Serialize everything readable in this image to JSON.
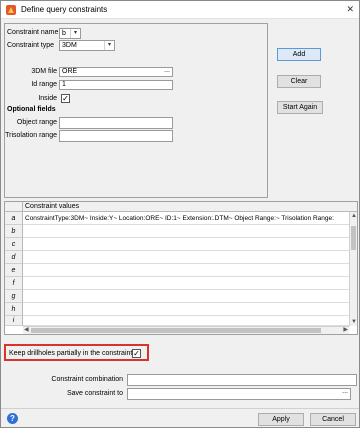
{
  "window": {
    "title": "Define query constraints",
    "close_glyph": "✕"
  },
  "form": {
    "constraint_name_label": "Constraint name",
    "constraint_name_value": "b",
    "constraint_type_label": "Constraint type",
    "constraint_type_value": "3DM",
    "file_label": "3DM file",
    "file_value": "ORE",
    "id_range_label": "Id range",
    "id_range_value": "1",
    "inside_label": "Inside",
    "inside_checked": true,
    "optional_label": "Optional fields",
    "object_range_label": "Object range",
    "object_range_value": "",
    "trisolation_label": "Trisolation range",
    "trisolation_value": "",
    "browse_glyph": "..."
  },
  "buttons": {
    "add": "Add",
    "clear": "Clear",
    "start_again": "Start Again",
    "apply": "Apply",
    "cancel": "Cancel"
  },
  "grid": {
    "column_header": "Constraint values",
    "rows": [
      {
        "label": "a",
        "value": "ConstraintType:3DM~ Inside:Y~ Location:ORE~ ID:1~ Extension:.DTM~ Object Range:~ Trisolation Range:"
      },
      {
        "label": "b",
        "value": ""
      },
      {
        "label": "c",
        "value": ""
      },
      {
        "label": "d",
        "value": ""
      },
      {
        "label": "e",
        "value": ""
      },
      {
        "label": "f",
        "value": ""
      },
      {
        "label": "g",
        "value": ""
      },
      {
        "label": "h",
        "value": ""
      },
      {
        "label": "i",
        "value": ""
      }
    ]
  },
  "bottom": {
    "keep_label": "Keep drillholes partially in the constraint",
    "keep_checked": true,
    "combination_label": "Constraint combination",
    "combination_value": "",
    "save_label": "Save constraint to",
    "save_value": ""
  },
  "colors": {
    "highlight": "#d9342b",
    "default_button": "#5b9bd5"
  }
}
